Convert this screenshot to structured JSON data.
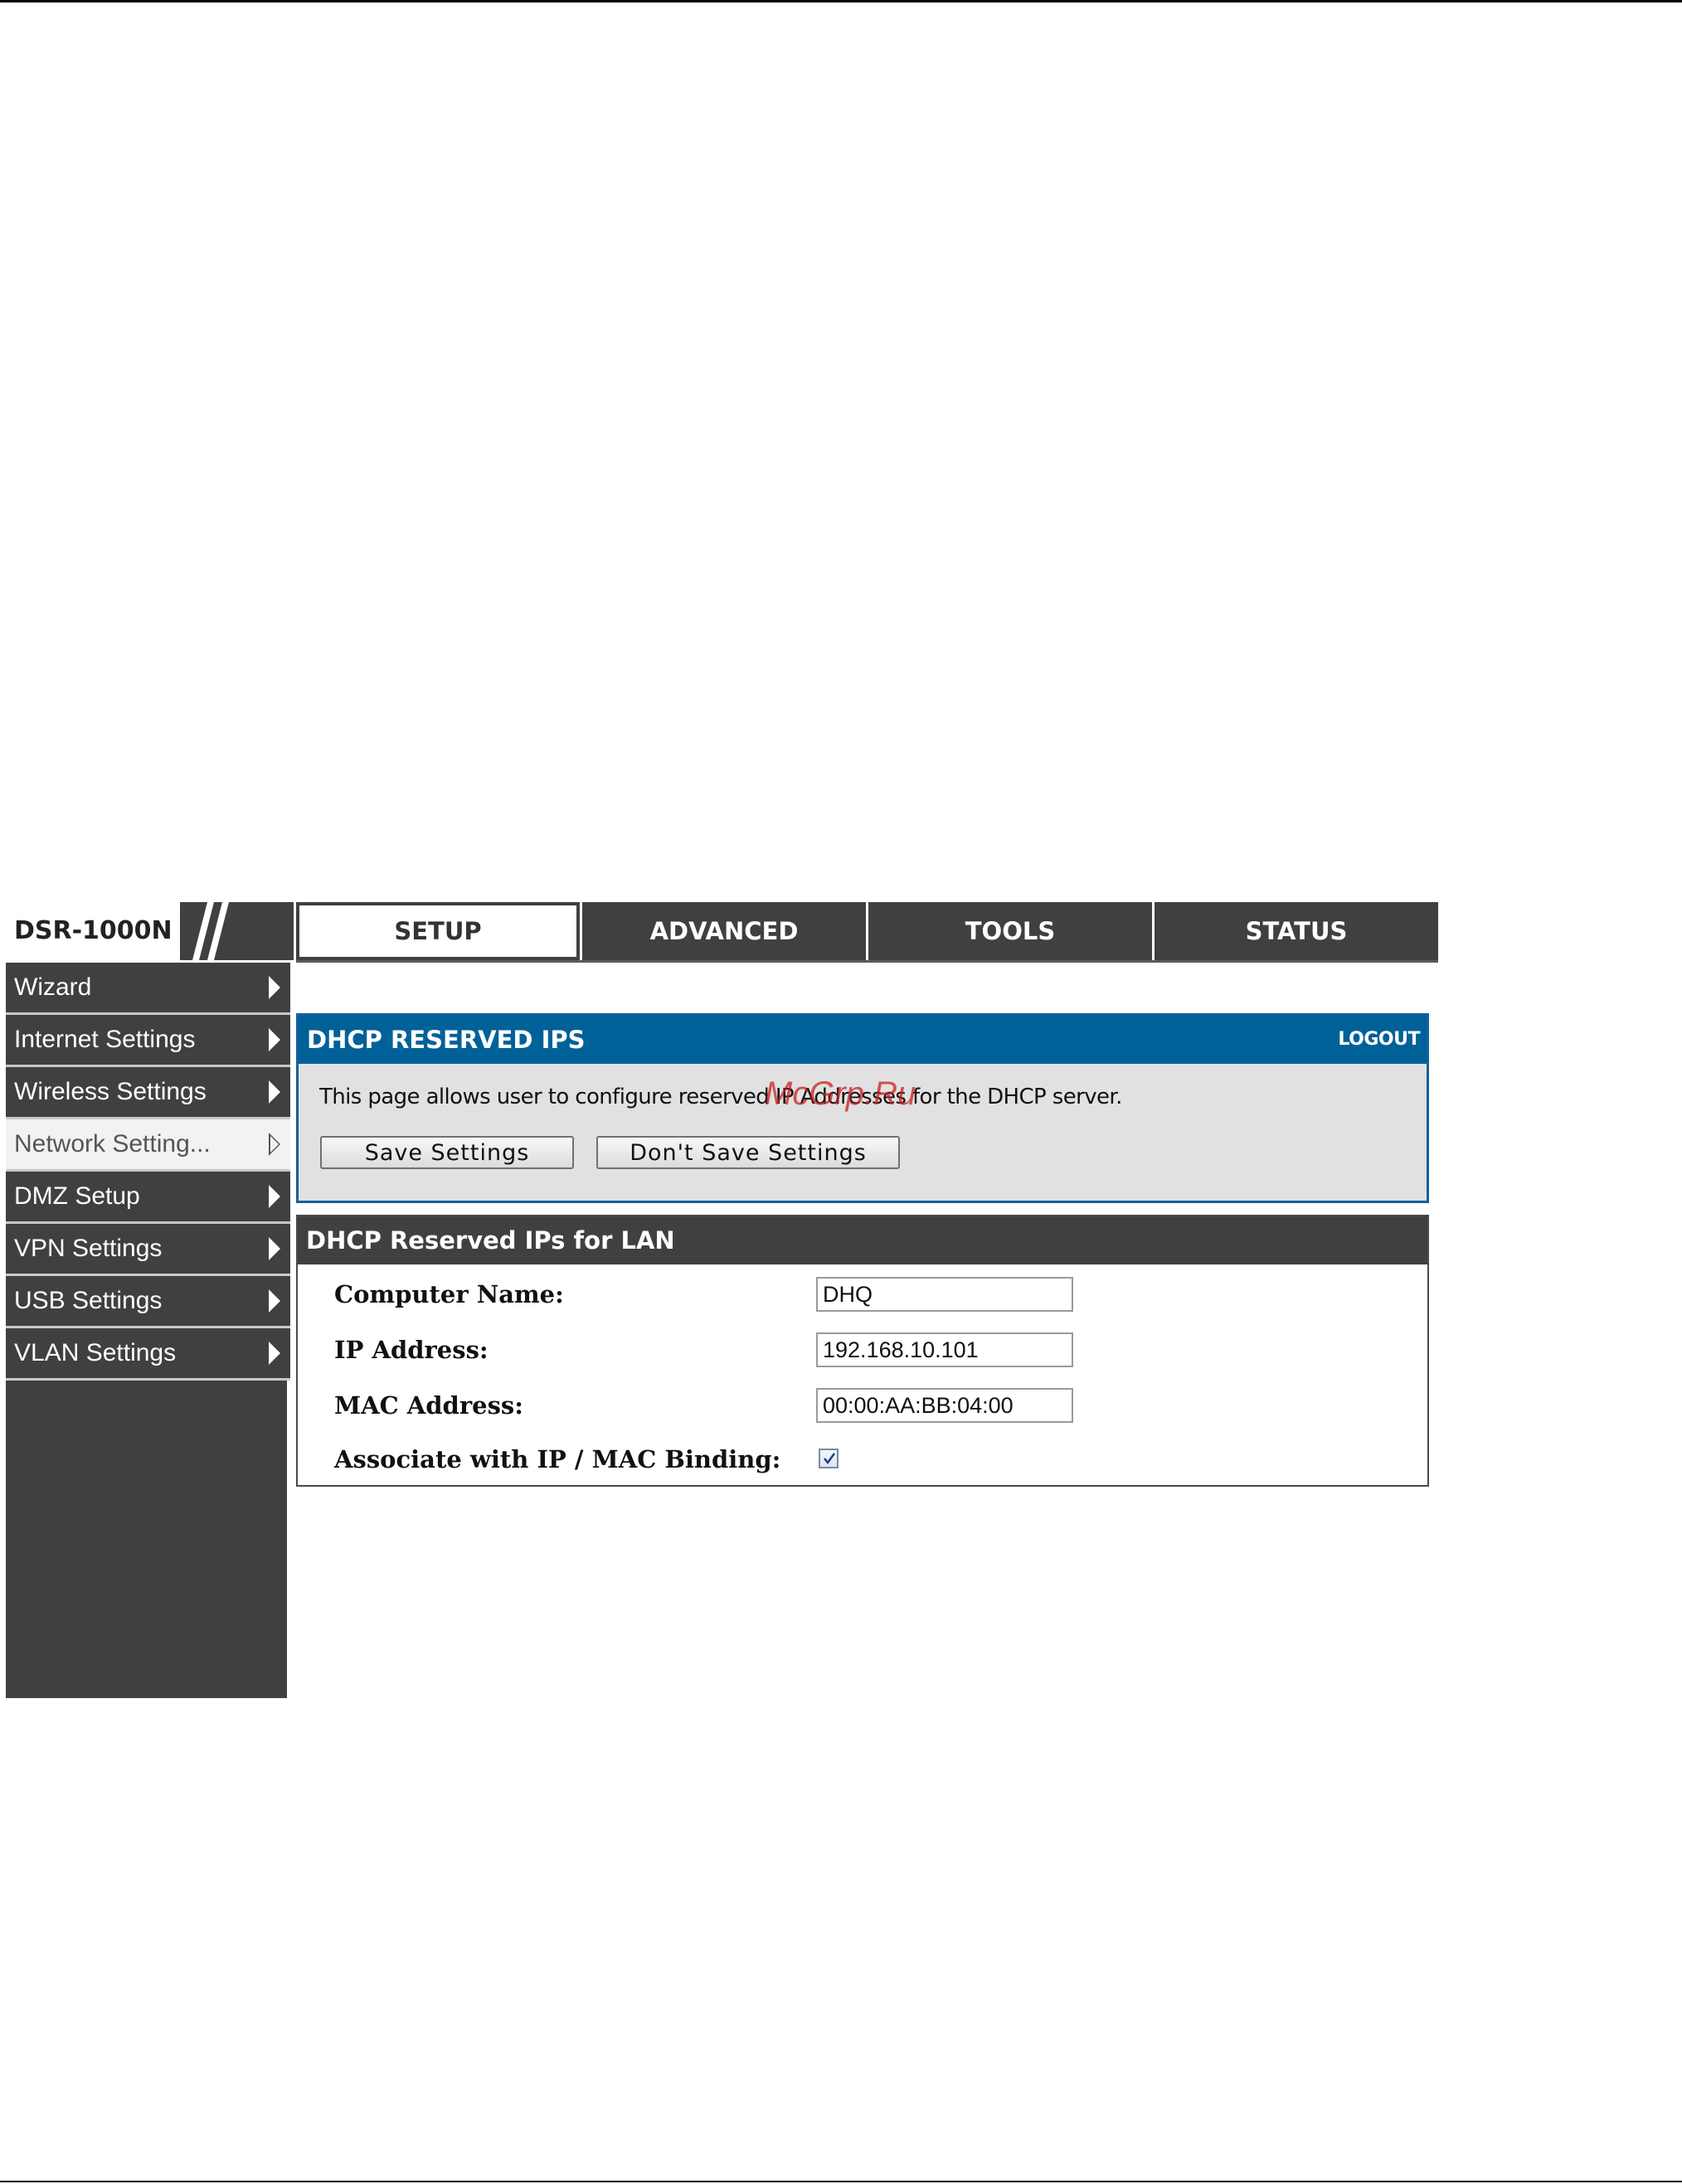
{
  "brand": {
    "model": "DSR-1000N"
  },
  "tabs": [
    {
      "label": "SETUP",
      "active": true
    },
    {
      "label": "ADVANCED",
      "active": false
    },
    {
      "label": "TOOLS",
      "active": false
    },
    {
      "label": "STATUS",
      "active": false
    }
  ],
  "sidebar": {
    "items": [
      {
        "label": "Wizard",
        "active": false
      },
      {
        "label": "Internet Settings",
        "active": false
      },
      {
        "label": "Wireless Settings",
        "active": false
      },
      {
        "label": "Network Setting...",
        "active": true
      },
      {
        "label": "DMZ Setup",
        "active": false
      },
      {
        "label": "VPN Settings",
        "active": false
      },
      {
        "label": "USB Settings",
        "active": false
      },
      {
        "label": "VLAN Settings",
        "active": false
      }
    ]
  },
  "info": {
    "title": "DHCP RESERVED IPS",
    "logout_label": "LOGOUT",
    "description": "This page allows user to configure reserved IP Addresses for the DHCP server.",
    "save_label": "Save Settings",
    "dont_save_label": "Don't Save Settings"
  },
  "watermark": "McGrp.Ru",
  "form": {
    "title": "DHCP Reserved IPs for LAN",
    "computer_name": {
      "label": "Computer Name:",
      "value": "DHQ"
    },
    "ip_address": {
      "label": "IP Address:",
      "value": "192.168.10.101"
    },
    "mac_address": {
      "label": "MAC Address:",
      "value": "00:00:AA:BB:04:00"
    },
    "binding": {
      "label": "Associate with IP / MAC Binding:",
      "checked": true
    }
  },
  "colors": {
    "panel_header": "#006199",
    "dark_gray": "#404040",
    "panel_bg": "#e1e1e1"
  }
}
